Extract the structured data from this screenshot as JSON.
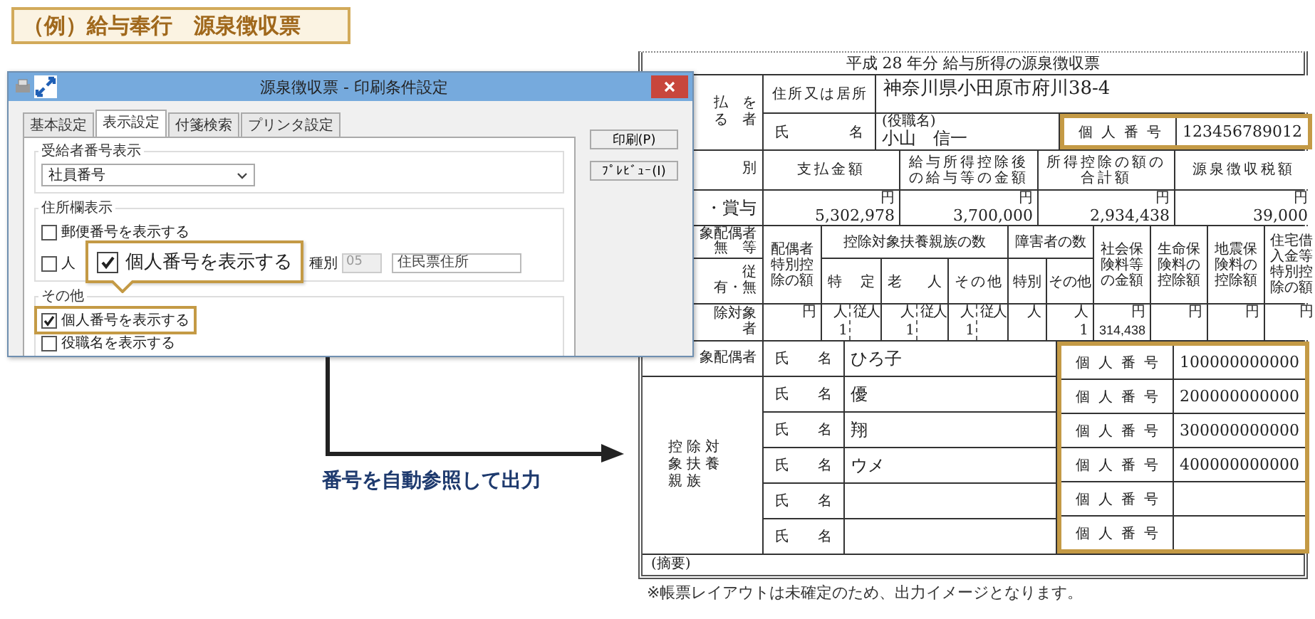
{
  "banner": {
    "title": "（例）給与奉行　源泉徴収票"
  },
  "dialog": {
    "title": "源泉徴収票 - 印刷条件設定",
    "tabs": [
      {
        "label": "基本設定",
        "selected": false
      },
      {
        "label": "表示設定",
        "selected": true
      },
      {
        "label": "付箋検索",
        "selected": false
      },
      {
        "label": "プリンタ設定",
        "selected": false
      }
    ],
    "buttons": [
      {
        "label": "印刷(P)"
      },
      {
        "label": "ﾌﾟﾚﾋﾞｭｰ(I)"
      }
    ],
    "recipient_group": {
      "title": "受給者番号表示",
      "select_value": "社員番号"
    },
    "address_group": {
      "title": "住所欄表示",
      "options": [
        {
          "label": "郵便番号を表示する",
          "checked": false
        },
        {
          "label": "人",
          "checked": false
        }
      ],
      "type_label": "種別",
      "type_code": "05",
      "address_source": "住民票住所"
    },
    "other_group": {
      "title": "その他",
      "options": [
        {
          "label": "個人番号を表示する",
          "checked": true
        },
        {
          "label": "役職名を表示する",
          "checked": false
        }
      ]
    }
  },
  "callout": {
    "label": "個人番号を表示する",
    "checked": true
  },
  "arrow_label": "番号を自動参照して出力",
  "form": {
    "title": "平成 28 年分 給与所得の源泉徴収票",
    "payee": {
      "side_labels": [
        "払　を",
        "る　者"
      ],
      "address_label": "住所又は居所",
      "address": "神奈川県小田原市府川38-4",
      "name_label": "氏名",
      "role_note": "(役職名)",
      "name": "小山　信一",
      "number_label": "個人番号",
      "number": "123456789012"
    },
    "amounts": {
      "side_labels": [
        "別",
        "・賞与"
      ],
      "columns": [
        {
          "header": "支払金額",
          "unit": "円",
          "value": "5,302,978"
        },
        {
          "header": "給与所得控除後の給与等の金額",
          "unit": "円",
          "value": "3,700,000"
        },
        {
          "header": "所得控除の額の合計額",
          "unit": "円",
          "value": "2,934,438"
        },
        {
          "header": "源泉徴収税額",
          "unit": "円",
          "value": "39,000"
        }
      ]
    },
    "deductions": {
      "spouse_lines": [
        "象配偶者",
        "無　等"
      ],
      "dependent_lines": [
        "従",
        "有・無"
      ],
      "spouse_special": "配偶者特別控除の額",
      "dependents_header": "控除対象扶養親族の数",
      "dependents_sub": [
        "特定",
        "老人",
        "その他"
      ],
      "disabled_header": "障害者の数",
      "disabled_sub": [
        "特別",
        "その他"
      ],
      "insurance_headers": [
        "社会保険料等の金額",
        "生命保険料の控除額",
        "地震保険料の控除額",
        "住宅借入金等特別控除の額"
      ],
      "count_row": {
        "label_lines": [
          "除対象",
          "者"
        ],
        "spouse_unit": "円",
        "dependents": [
          {
            "unit": "人",
            "sub_unit": "従人",
            "value": "1"
          },
          {
            "unit": "人",
            "sub_unit": "従人",
            "value": "1"
          },
          {
            "unit": "人",
            "sub_unit": "従人",
            "value": "1"
          }
        ],
        "disabled": [
          {
            "unit": "人"
          },
          {
            "unit": "人",
            "value": "1"
          }
        ],
        "insurance": [
          {
            "unit": "円",
            "value": "314,438"
          },
          {
            "unit": "円"
          },
          {
            "unit": "円"
          },
          {
            "unit": "円"
          }
        ]
      }
    },
    "spouse": {
      "label": "象配偶者",
      "name_label": "氏名",
      "name": "ひろ子",
      "number_label": "個人番号",
      "number": "100000000000"
    },
    "family": {
      "label": "控除対象扶養親族",
      "rows": [
        {
          "name_label": "氏名",
          "name": "優",
          "number_label": "個人番号",
          "number": "200000000000"
        },
        {
          "name_label": "氏名",
          "name": "翔",
          "number_label": "個人番号",
          "number": "300000000000"
        },
        {
          "name_label": "氏名",
          "name": "ウメ",
          "number_label": "個人番号",
          "number": "400000000000"
        },
        {
          "name_label": "氏名",
          "number_label": "個人番号"
        },
        {
          "name_label": "氏名",
          "number_label": "個人番号"
        }
      ]
    },
    "remarks_label": "(摘要)"
  },
  "footnote": "※帳票レイアウトは未確定のため、出力イメージとなります。"
}
